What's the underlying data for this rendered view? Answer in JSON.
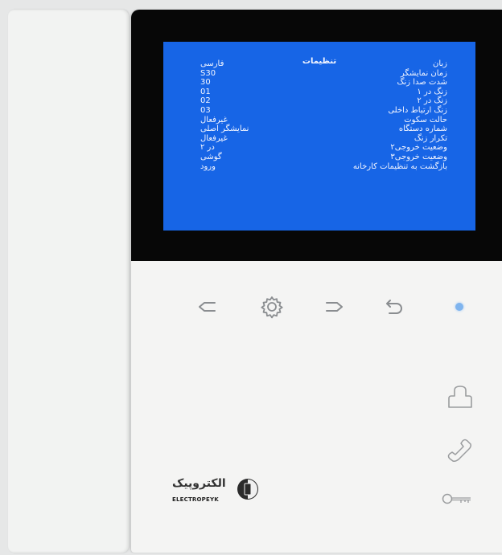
{
  "screen": {
    "title": "تنظیمات",
    "rows": [
      {
        "label": "زبان",
        "value": "فارسی"
      },
      {
        "label": "زمان نمایشگر",
        "value": "S30"
      },
      {
        "label": "شدت صدا زنگ",
        "value": "30"
      },
      {
        "label": "زنگ در ۱",
        "value": "01"
      },
      {
        "label": "زنگ در ۲",
        "value": "02"
      },
      {
        "label": "زنگ ارتباط داخلی",
        "value": "03"
      },
      {
        "label": "حالت سکوت",
        "value": "غیرفعال"
      },
      {
        "label": "شماره دستگاه",
        "value": "نمایشگر اصلی"
      },
      {
        "label": "تکرار زنگ",
        "value": "غیرفعال"
      },
      {
        "label": "وضعیت خروجی۲",
        "value": "در ۲"
      },
      {
        "label": "وضعیت خروجی۳",
        "value": "گوشی"
      },
      {
        "label": "بازگشت به تنظیمات کارخانه",
        "value": "ورود"
      }
    ]
  },
  "buttons": {
    "back": "back-arrow-icon",
    "settings": "gear-icon",
    "forward": "forward-arrow-icon",
    "return": "return-icon",
    "indicator_color": "#7fb4ee"
  },
  "side_buttons": [
    "unlock-icon",
    "handset-icon",
    "key-icon"
  ],
  "brand": {
    "name_fa": "الکتروپیک",
    "name_en": "ELECTROPEYK"
  }
}
